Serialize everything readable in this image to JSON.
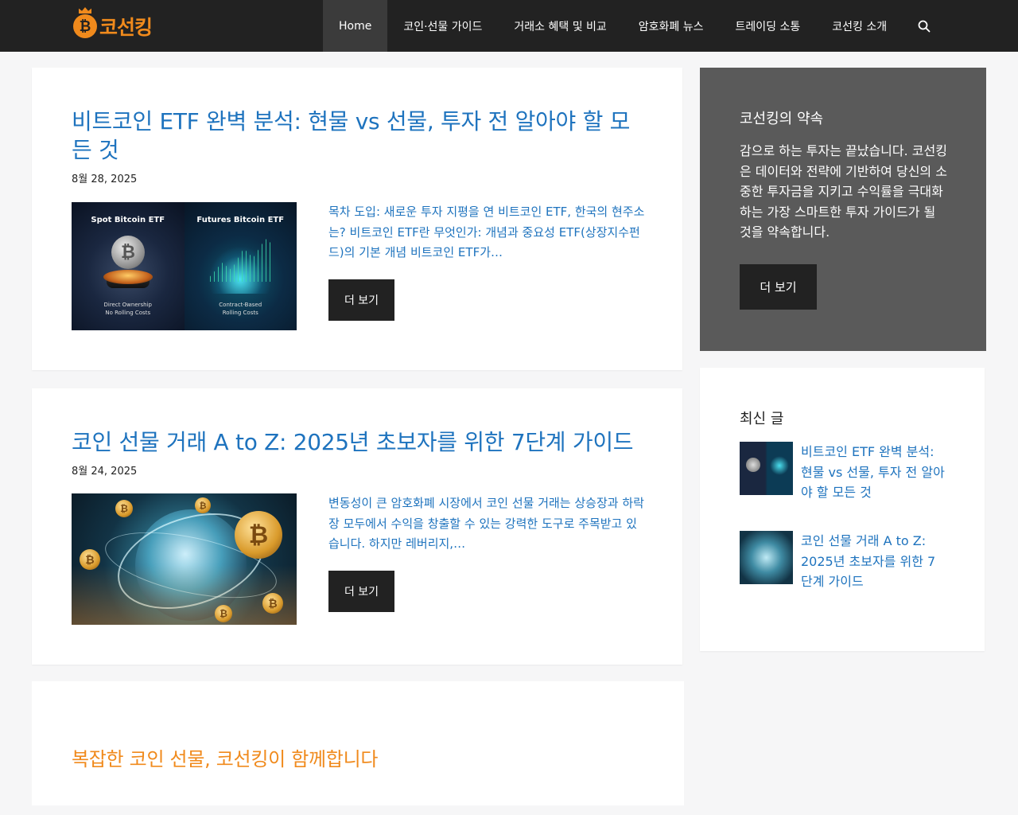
{
  "site": {
    "logo_text": "코선킹",
    "logo_symbol": "₿"
  },
  "nav": {
    "items": [
      {
        "label": "Home"
      },
      {
        "label": "코인·선물 가이드"
      },
      {
        "label": "거래소 혜택 및 비교"
      },
      {
        "label": "암호화폐 뉴스"
      },
      {
        "label": "트레이딩 소통"
      },
      {
        "label": "코선킹 소개"
      }
    ],
    "search_icon": "search-icon"
  },
  "posts": [
    {
      "title": "비트코인 ETF 완벽 분석: 현물 vs 선물, 투자 전 알아야 할 모든 것",
      "date": "8월 28, 2025",
      "excerpt": "목차 도입: 새로운 투자 지평을 연 비트코인 ETF, 한국의 현주소는? 비트코인 ETF란 무엇인가: 개념과 중요성 ETF(상장지수펀드)의 기본 개념 비트코인 ETF가…",
      "more_label": "더 보기",
      "thumb": {
        "left_label": "Spot Bitcoin ETF",
        "right_label": "Futures Bitcoin ETF",
        "left_sub1": "Direct Ownership",
        "left_sub2": "No Rolling Costs",
        "right_sub1": "Contract-Based",
        "right_sub2": "Rolling Costs"
      }
    },
    {
      "title": "코인 선물 거래 A to Z: 2025년 초보자를 위한 7단계 가이드",
      "date": "8월 24, 2025",
      "excerpt": "변동성이 큰 암호화폐 시장에서 코인 선물 거래는 상승장과 하락장 모두에서 수익을 창출할 수 있는 강력한 도구로 주목받고 있습니다. 하지만 레버리지,…",
      "more_label": "더 보기"
    }
  ],
  "sidebar": {
    "promise": {
      "title": "코선킹의 약속",
      "text": "감으로 하는 투자는 끝났습니다. 코선킹은 데이터와 전략에 기반하여 당신의 소중한 투자금을 지키고 수익률을 극대화하는 가장 스마트한 투자 가이드가 될 것을 약속합니다.",
      "button_label": "더 보기",
      "background": "#5a5a5a"
    },
    "recent": {
      "title": "최신 글",
      "items": [
        {
          "label": "비트코인 ETF 완벽 분석: 현물 vs 선물, 투자 전 알아야 할 모든 것"
        },
        {
          "label": "코인 선물 거래 A to Z: 2025년 초보자를 위한 7단계 가이드"
        }
      ]
    }
  },
  "bottom": {
    "title": "복잡한 코인 선물, 코선킹이 함께합니다"
  },
  "colors": {
    "header": "#222222",
    "link": "#1e73be",
    "accent": "#f08a1c",
    "button": "#222222"
  }
}
